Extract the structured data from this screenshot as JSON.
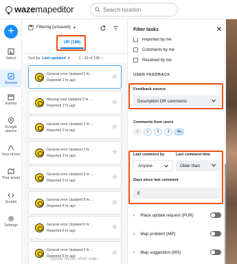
{
  "app": {
    "brand_bold": "waze",
    "brand_light": "mapeditor",
    "search_placeholder": "Search location"
  },
  "rail": {
    "add_label": "+",
    "items": [
      {
        "label": "Select",
        "icon": "cursor-icon"
      },
      {
        "label": "Review",
        "icon": "review-icon",
        "active": true
      },
      {
        "label": "Events",
        "icon": "calendar-icon"
      },
      {
        "label": "Google places",
        "icon": "google-places-icon"
      },
      {
        "label": "Your drives",
        "icon": "drives-icon"
      },
      {
        "label": "Your areas",
        "icon": "areas-icon"
      },
      {
        "label": "Scripts",
        "icon": "code-icon"
      },
      {
        "label": "Settings",
        "icon": "gear-icon"
      }
    ]
  },
  "list": {
    "filter_label": "Filtering (unsaved)",
    "tab_label": "UR (196)",
    "sort_prefix": "Sort by",
    "sort_value": "Last updated",
    "range_text": "1 - 30 of 196",
    "cards": [
      {
        "title": "General error Updated 5 hr...",
        "sub": "Reported 1 hr ago"
      },
      {
        "title": "Missing road Updated 2 hr ...",
        "sub": "Reported 2 hr ago"
      },
      {
        "title": "General error Updated 2 hr ...",
        "sub": "Reported 2 hr ago"
      },
      {
        "title": "General error Updated 3 hr ...",
        "sub": "Reported 3 hr ago"
      },
      {
        "title": "General error Updated 5 hr ...",
        "sub": "Reported 5 hr ago"
      },
      {
        "title": "General error Updated 8 hr ...",
        "sub": "Reported 8 hr ago"
      },
      {
        "title": "General error Updated 6 hr ...",
        "sub": "Reported 6 hr ago"
      },
      {
        "title": "General error Updated 6 hr ...",
        "sub": "Reported 6 hr ago"
      }
    ],
    "footer": "Update results when map..."
  },
  "drawer": {
    "title": "Filter tasks",
    "checks": [
      "Reported by me",
      "Comments by me",
      "Resolved by me"
    ],
    "section": "USER FEEDBACK",
    "feedback_source_label": "Feedback source",
    "feedback_source_value": "Description OR comments",
    "comments_from_users_label": "Comments from users",
    "chips": [
      "0",
      "1",
      "2",
      "3",
      "4+"
    ],
    "last_comment_by_label": "Last comment by",
    "last_comment_by_value": "Anyone",
    "last_comment_time_label": "Last comment time",
    "last_comment_time_value": "Older than",
    "days_label": "Days since last comment",
    "days_value": "8",
    "toggles": [
      "Place update request (PUR)",
      "Map problem (MP)",
      "Map suggestion (MS)"
    ]
  }
}
